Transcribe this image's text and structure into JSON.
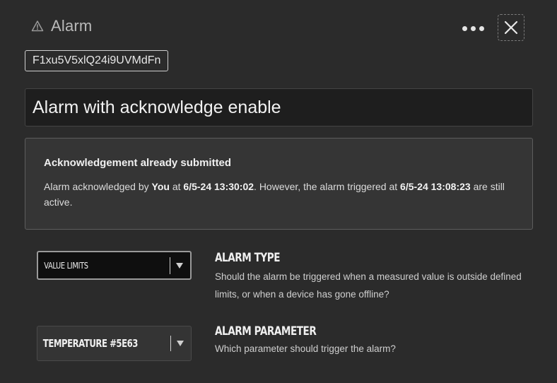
{
  "header": {
    "title": "Alarm",
    "icon": "warning-icon"
  },
  "toolbar": {
    "more_icon": "more-horizontal-icon",
    "close_icon": "close-icon"
  },
  "alarm": {
    "id": "F1xu5V5xlQ24i9UVMdFn",
    "name": "Alarm with acknowledge enable"
  },
  "acknowledgement": {
    "heading": "Acknowledgement already submitted",
    "text_prefix": "Alarm acknowledged by ",
    "user": "You",
    "text_at": " at ",
    "ack_time": "6/5-24 13:30:02",
    "text_middle": ". However, the alarm triggered at ",
    "trigger_time": "6/5-24 13:08:23",
    "text_suffix": " are still active."
  },
  "alarm_type": {
    "selected": "Value limits",
    "label": "Alarm type",
    "description": "Should the alarm be triggered when a measured value is outside defined limits, or when a device has gone offline?"
  },
  "alarm_parameter": {
    "selected": "Temperature #5E63",
    "label": "Alarm parameter",
    "description": "Which parameter should trigger the alarm?"
  },
  "colors": {
    "background": "#2b2b2b",
    "input_background": "#1e1e1e",
    "box_background": "#353535",
    "text": "#e6e6e6"
  }
}
